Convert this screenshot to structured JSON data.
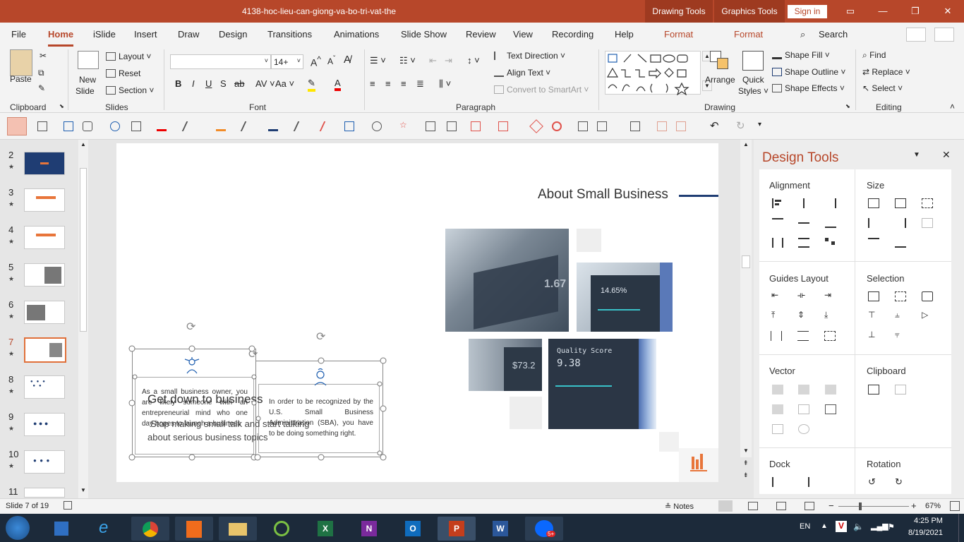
{
  "window": {
    "title": "4138-hoc-lieu-can-giong-va-bo-tri-vat-the",
    "ctx_drawing": "Drawing Tools",
    "ctx_graphics": "Graphics Tools",
    "signin": "Sign in"
  },
  "tabs": [
    "File",
    "Home",
    "iSlide",
    "Insert",
    "Draw",
    "Design",
    "Transitions",
    "Animations",
    "Slide Show",
    "Review",
    "View",
    "Recording",
    "Help",
    "Format",
    "Format"
  ],
  "search": "Search",
  "ribbon": {
    "clipboard": {
      "label": "Clipboard",
      "paste": "Paste"
    },
    "slides": {
      "label": "Slides",
      "new_slide": "New",
      "new_slide2": "Slide",
      "layout": "Layout",
      "reset": "Reset",
      "section": "Section"
    },
    "font": {
      "label": "Font",
      "size": "14+",
      "bold": "B",
      "italic": "I",
      "underline": "U",
      "shadow": "S",
      "strike": "ab",
      "case": "Aa"
    },
    "paragraph": {
      "label": "Paragraph",
      "text_direction": "Text Direction",
      "align_text": "Align Text",
      "smartart": "Convert to SmartArt"
    },
    "drawing": {
      "label": "Drawing",
      "arrange": "Arrange",
      "quick": "Quick",
      "styles": "Styles",
      "fill": "Shape Fill",
      "outline": "Shape Outline",
      "effects": "Shape Effects"
    },
    "editing": {
      "label": "Editing",
      "find": "Find",
      "replace": "Replace",
      "select": "Select"
    }
  },
  "thumbs": [
    {
      "n": "2"
    },
    {
      "n": "3"
    },
    {
      "n": "4"
    },
    {
      "n": "5"
    },
    {
      "n": "6"
    },
    {
      "n": "7"
    },
    {
      "n": "8"
    },
    {
      "n": "9"
    },
    {
      "n": "10"
    },
    {
      "n": "11"
    }
  ],
  "slide": {
    "heading": "About Small Business",
    "big_title": "Get down to business",
    "sub1": "Stop making small talk and start talking",
    "sub2": "about serious business topics",
    "box1": "As a small business owner, you are likely someone with an entrepreneurial mind who one day hopes to launch a business",
    "box2": "In order to be recognized by the U.S. Small Business Administration (SBA), you have to be doing something right.",
    "screen1": "14.65%",
    "screen2": "Quality Score",
    "screen2b": "9.38",
    "screen3": "$73.2",
    "screen4": "1.67"
  },
  "design_tools": {
    "title": "Design Tools",
    "alignment": "Alignment",
    "size": "Size",
    "guides": "Guides Layout",
    "selection": "Selection",
    "vector": "Vector",
    "clipboard": "Clipboard",
    "dock": "Dock",
    "rotation": "Rotation"
  },
  "status": {
    "slide": "Slide 7 of 19",
    "notes": "Notes",
    "zoom": "67%"
  },
  "tray": {
    "lang": "EN",
    "time": "4:25 PM",
    "date": "8/19/2021",
    "zalo": "5+"
  },
  "colors": {
    "accent": "#b7472a",
    "navy": "#1f3d73",
    "orange": "#e8753a"
  }
}
